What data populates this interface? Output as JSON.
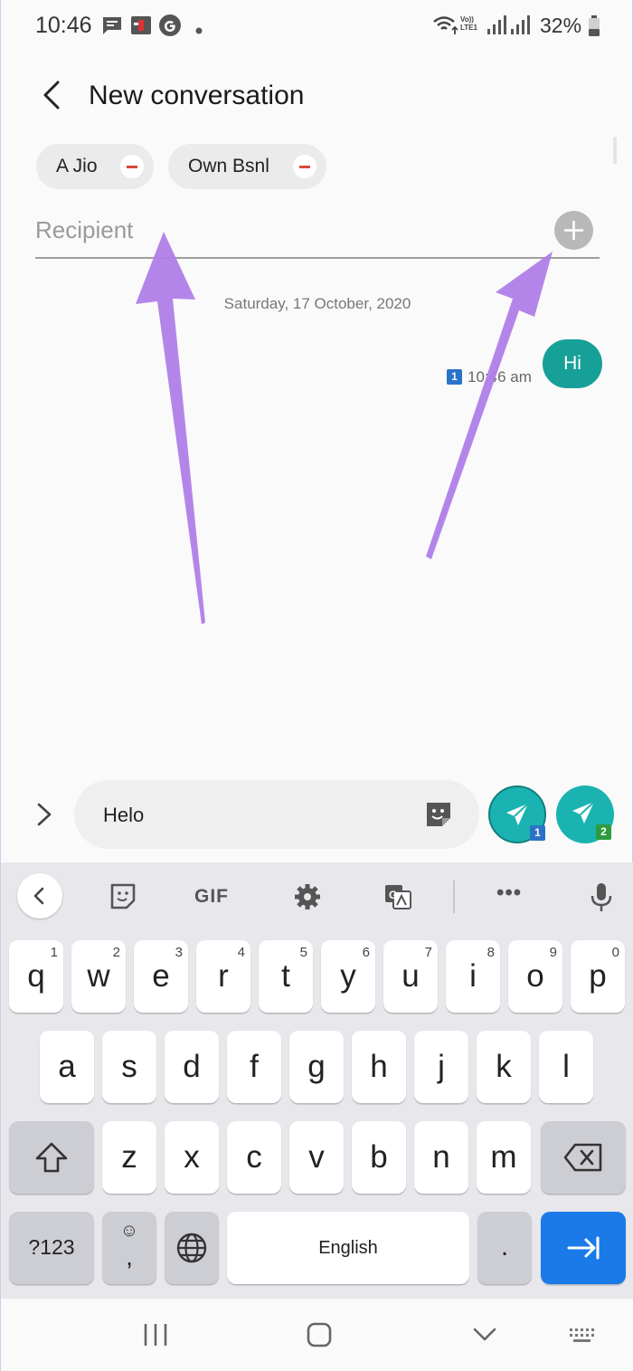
{
  "status_bar": {
    "time": "10:46",
    "volte_label_line1": "Vo))",
    "volte_label_line2": "LTE1",
    "battery_percent": "32%"
  },
  "header": {
    "title": "New conversation"
  },
  "recipients": {
    "chips": [
      {
        "label": "A Jio"
      },
      {
        "label": "Own Bsnl"
      }
    ],
    "input_placeholder": "Recipient",
    "input_value": ""
  },
  "conversation": {
    "date_separator": "Saturday, 17 October, 2020",
    "messages": [
      {
        "text": "Hi",
        "time": "10:46 am",
        "sim": "1"
      }
    ]
  },
  "composer": {
    "text": "Helo",
    "send_buttons": [
      {
        "sim": "1",
        "badge_color": "#2a73c9"
      },
      {
        "sim": "2",
        "badge_color": "#2e9b3e"
      }
    ]
  },
  "keyboard": {
    "toolbar": {
      "gif_label": "GIF",
      "items": [
        "chevron-left-icon",
        "sticker-icon",
        "gif",
        "gear-icon",
        "translate-icon",
        "more-icon",
        "mic-icon"
      ]
    },
    "row1": [
      {
        "key": "q",
        "num": "1"
      },
      {
        "key": "w",
        "num": "2"
      },
      {
        "key": "e",
        "num": "3"
      },
      {
        "key": "r",
        "num": "4"
      },
      {
        "key": "t",
        "num": "5"
      },
      {
        "key": "y",
        "num": "6"
      },
      {
        "key": "u",
        "num": "7"
      },
      {
        "key": "i",
        "num": "8"
      },
      {
        "key": "o",
        "num": "9"
      },
      {
        "key": "p",
        "num": "0"
      }
    ],
    "row2": [
      "a",
      "s",
      "d",
      "f",
      "g",
      "h",
      "j",
      "k",
      "l"
    ],
    "row3": [
      "z",
      "x",
      "c",
      "v",
      "b",
      "n",
      "m"
    ],
    "symbols_label": "?123",
    "emoji_comma_top": "☺",
    "emoji_comma_bottom": ",",
    "space_label": "English",
    "period_label": ".",
    "accent_color": "#1a7ae8"
  },
  "colors": {
    "send_teal": "#1bb3b1",
    "bubble_teal": "#17a097",
    "annotation_arrow": "#b07ee8"
  }
}
